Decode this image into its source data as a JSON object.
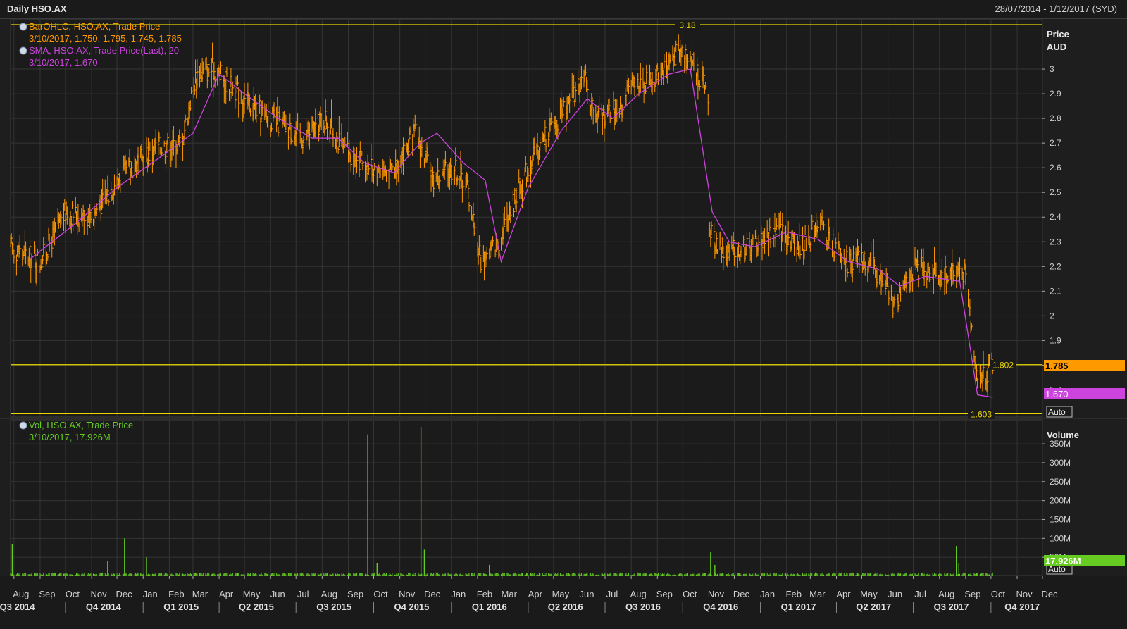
{
  "window": {
    "title": "Daily HSO.AX",
    "date_range": "28/07/2014 - 1/12/2017 (SYD)"
  },
  "colors": {
    "price_bar": "#ff9900",
    "sma": "#cc44dd",
    "volume": "#66cc22",
    "hline": "#e8d800",
    "grid": "#353535",
    "axis_text": "#d0d0d0"
  },
  "chart_data": [
    {
      "type": "bar",
      "subtype": "ohlc",
      "legend": [
        {
          "label": "BarOHLC, HSO.AX, Trade Price",
          "value": "3/10/2017, 1.750, 1.795, 1.745, 1.785",
          "color": "#ff9900"
        },
        {
          "label": "SMA, HSO.AX, Trade Price(Last),  20",
          "value": "3/10/2017, 1.670",
          "color": "#cc44dd"
        }
      ],
      "ylabel": "Price",
      "yunit": "AUD",
      "ylim": [
        1.59,
        3.2
      ],
      "yticks": [
        "1.7",
        "1.8",
        "1.9",
        "2",
        "2.1",
        "2.2",
        "2.3",
        "2.4",
        "2.5",
        "2.6",
        "2.7",
        "2.8",
        "2.9",
        "3"
      ],
      "xlim": [
        "2014-07-28",
        "2017-12-01"
      ],
      "grid": true,
      "series": [
        {
          "name": "BarOHLC, HSO.AX, Trade Price",
          "x": [
            "2014-07-28",
            "2014-09-01",
            "2014-10-01",
            "2014-11-01",
            "2014-12-01",
            "2015-01-15",
            "2015-02-15",
            "2015-03-05",
            "2015-03-25",
            "2015-04-10",
            "2015-05-10",
            "2015-06-10",
            "2015-07-10",
            "2015-08-05",
            "2015-08-25",
            "2015-09-20",
            "2015-10-20",
            "2015-11-20",
            "2015-12-10",
            "2016-01-05",
            "2016-01-20",
            "2016-02-05",
            "2016-02-25",
            "2016-03-25",
            "2016-04-25",
            "2016-05-20",
            "2016-06-05",
            "2016-06-20",
            "2016-07-15",
            "2016-08-10",
            "2016-08-25",
            "2016-09-20",
            "2016-10-05",
            "2016-10-20",
            "2016-10-31",
            "2016-11-01",
            "2016-11-20",
            "2016-12-20",
            "2017-01-20",
            "2017-02-20",
            "2017-03-10",
            "2017-04-10",
            "2017-05-10",
            "2017-05-31",
            "2017-06-10",
            "2017-06-20",
            "2017-07-10",
            "2017-08-01",
            "2017-08-25",
            "2017-09-01",
            "2017-09-15",
            "2017-10-03"
          ],
          "close": [
            2.28,
            2.22,
            2.42,
            2.4,
            2.55,
            2.68,
            2.7,
            2.98,
            3.0,
            2.95,
            2.85,
            2.78,
            2.72,
            2.8,
            2.68,
            2.62,
            2.58,
            2.74,
            2.55,
            2.6,
            2.52,
            2.22,
            2.3,
            2.55,
            2.75,
            2.85,
            2.98,
            2.8,
            2.85,
            2.95,
            2.95,
            3.05,
            3.08,
            2.98,
            2.9,
            2.35,
            2.25,
            2.28,
            2.35,
            2.28,
            2.38,
            2.22,
            2.22,
            2.1,
            2.02,
            2.16,
            2.2,
            2.16,
            2.19,
            2.16,
            1.75,
            1.785
          ]
        },
        {
          "name": "SMA, HSO.AX, Trade Price(Last),  20",
          "x": [
            "2014-08-20",
            "2014-10-15",
            "2014-12-01",
            "2015-01-20",
            "2015-03-01",
            "2015-04-01",
            "2015-05-01",
            "2015-06-10",
            "2015-07-20",
            "2015-08-20",
            "2015-09-20",
            "2015-10-25",
            "2015-11-25",
            "2015-12-15",
            "2016-01-15",
            "2016-02-10",
            "2016-02-29",
            "2016-04-01",
            "2016-05-10",
            "2016-06-10",
            "2016-07-10",
            "2016-08-10",
            "2016-09-15",
            "2016-10-10",
            "2016-11-05",
            "2016-11-25",
            "2016-12-25",
            "2017-02-01",
            "2017-03-10",
            "2017-04-15",
            "2017-05-20",
            "2017-06-15",
            "2017-07-15",
            "2017-08-25",
            "2017-09-15",
            "2017-10-03"
          ],
          "values": [
            2.23,
            2.38,
            2.52,
            2.64,
            2.74,
            2.98,
            2.9,
            2.8,
            2.72,
            2.72,
            2.62,
            2.58,
            2.7,
            2.74,
            2.62,
            2.55,
            2.22,
            2.52,
            2.75,
            2.88,
            2.8,
            2.9,
            2.98,
            3.0,
            2.42,
            2.3,
            2.28,
            2.34,
            2.31,
            2.22,
            2.19,
            2.12,
            2.16,
            2.14,
            1.68,
            1.67
          ]
        }
      ],
      "hlines": [
        {
          "y": 3.18,
          "label": "3.18"
        },
        {
          "y": 1.802,
          "label": "1.802"
        },
        {
          "y": 1.603,
          "label": "1.603"
        }
      ],
      "value_tags": [
        {
          "value": "1.785",
          "color": "#ff9900"
        },
        {
          "value": "1.670",
          "color": "#cc44dd"
        }
      ],
      "scale_button": "Auto"
    },
    {
      "type": "bar",
      "subtype": "volume",
      "legend": [
        {
          "label": "Vol, HSO.AX, Trade Price",
          "value": "3/10/2017, 17.926M",
          "color": "#66cc22"
        }
      ],
      "ylabel": "Volume",
      "ylim": [
        0,
        380
      ],
      "yunit_suffix": "M",
      "yticks": [
        "50M",
        "100M",
        "150M",
        "200M",
        "250M",
        "300M",
        "350M"
      ],
      "spikes": [
        {
          "date": "2014-07-30",
          "value": 85
        },
        {
          "date": "2014-11-20",
          "value": 40
        },
        {
          "date": "2014-12-10",
          "value": 100
        },
        {
          "date": "2015-01-05",
          "value": 50
        },
        {
          "date": "2015-09-24",
          "value": 375
        },
        {
          "date": "2015-10-05",
          "value": 35
        },
        {
          "date": "2015-11-26",
          "value": 425
        },
        {
          "date": "2015-11-30",
          "value": 70
        },
        {
          "date": "2016-02-15",
          "value": 30
        },
        {
          "date": "2016-11-03",
          "value": 65
        },
        {
          "date": "2016-11-08",
          "value": 30
        },
        {
          "date": "2017-08-21",
          "value": 80
        },
        {
          "date": "2017-08-24",
          "value": 35
        }
      ],
      "base_value": 7,
      "last_value_tag": {
        "value": "17.926M",
        "color": "#66cc22"
      },
      "scale_button": "Auto"
    }
  ],
  "x_axis": {
    "months": [
      {
        "label": "Aug",
        "date": "2014-08-01"
      },
      {
        "label": "Sep",
        "date": "2014-09-01"
      },
      {
        "label": "Oct",
        "date": "2014-10-01"
      },
      {
        "label": "Nov",
        "date": "2014-11-01"
      },
      {
        "label": "Dec",
        "date": "2014-12-01"
      },
      {
        "label": "Jan",
        "date": "2015-01-01"
      },
      {
        "label": "Feb",
        "date": "2015-02-01"
      },
      {
        "label": "Mar",
        "date": "2015-03-01"
      },
      {
        "label": "Apr",
        "date": "2015-04-01"
      },
      {
        "label": "May",
        "date": "2015-05-01"
      },
      {
        "label": "Jun",
        "date": "2015-06-01"
      },
      {
        "label": "Jul",
        "date": "2015-07-01"
      },
      {
        "label": "Aug",
        "date": "2015-08-01"
      },
      {
        "label": "Sep",
        "date": "2015-09-01"
      },
      {
        "label": "Oct",
        "date": "2015-10-01"
      },
      {
        "label": "Nov",
        "date": "2015-11-01"
      },
      {
        "label": "Dec",
        "date": "2015-12-01"
      },
      {
        "label": "Jan",
        "date": "2016-01-01"
      },
      {
        "label": "Feb",
        "date": "2016-02-01"
      },
      {
        "label": "Mar",
        "date": "2016-03-01"
      },
      {
        "label": "Apr",
        "date": "2016-04-01"
      },
      {
        "label": "May",
        "date": "2016-05-01"
      },
      {
        "label": "Jun",
        "date": "2016-06-01"
      },
      {
        "label": "Jul",
        "date": "2016-07-01"
      },
      {
        "label": "Aug",
        "date": "2016-08-01"
      },
      {
        "label": "Sep",
        "date": "2016-09-01"
      },
      {
        "label": "Oct",
        "date": "2016-10-01"
      },
      {
        "label": "Nov",
        "date": "2016-11-01"
      },
      {
        "label": "Dec",
        "date": "2016-12-01"
      },
      {
        "label": "Jan",
        "date": "2017-01-01"
      },
      {
        "label": "Feb",
        "date": "2017-02-01"
      },
      {
        "label": "Mar",
        "date": "2017-03-01"
      },
      {
        "label": "Apr",
        "date": "2017-04-01"
      },
      {
        "label": "May",
        "date": "2017-05-01"
      },
      {
        "label": "Jun",
        "date": "2017-06-01"
      },
      {
        "label": "Jul",
        "date": "2017-07-01"
      },
      {
        "label": "Aug",
        "date": "2017-08-01"
      },
      {
        "label": "Sep",
        "date": "2017-09-01"
      },
      {
        "label": "Oct",
        "date": "2017-10-01"
      },
      {
        "label": "Nov",
        "date": "2017-11-01"
      },
      {
        "label": "Dec",
        "date": "2017-12-01"
      }
    ],
    "quarters": [
      {
        "label": "Q3 2014",
        "date": "2014-08-05"
      },
      {
        "label": "Q4 2014",
        "date": "2014-11-15"
      },
      {
        "label": "Q1 2015",
        "date": "2015-02-15"
      },
      {
        "label": "Q2 2015",
        "date": "2015-05-15"
      },
      {
        "label": "Q3 2015",
        "date": "2015-08-15"
      },
      {
        "label": "Q4 2015",
        "date": "2015-11-15"
      },
      {
        "label": "Q1 2016",
        "date": "2016-02-15"
      },
      {
        "label": "Q2 2016",
        "date": "2016-05-15"
      },
      {
        "label": "Q3 2016",
        "date": "2016-08-15"
      },
      {
        "label": "Q4 2016",
        "date": "2016-11-15"
      },
      {
        "label": "Q1 2017",
        "date": "2017-02-15"
      },
      {
        "label": "Q2 2017",
        "date": "2017-05-15"
      },
      {
        "label": "Q3 2017",
        "date": "2017-08-15"
      },
      {
        "label": "Q4 2017",
        "date": "2017-11-07"
      }
    ],
    "quarter_boundaries": [
      "2014-10-01",
      "2015-01-01",
      "2015-04-01",
      "2015-07-01",
      "2015-10-01",
      "2016-01-01",
      "2016-04-01",
      "2016-07-01",
      "2016-10-01",
      "2017-01-01",
      "2017-04-01",
      "2017-07-01",
      "2017-10-01"
    ]
  }
}
